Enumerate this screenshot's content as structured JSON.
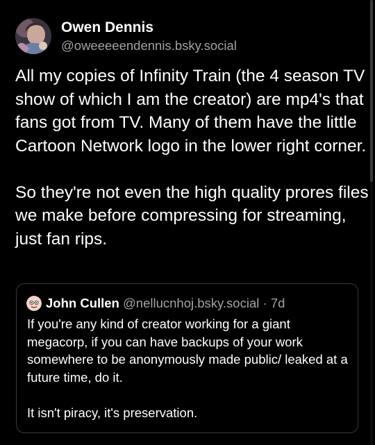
{
  "post": {
    "author": {
      "display_name": "Owen Dennis",
      "handle": "@oweeeeendennis.bsky.social",
      "avatar_icon": "profile-photo"
    },
    "text_paragraphs": [
      "All my copies of Infinity Train (the 4 season TV show of which I am the creator) are mp4's that fans got from TV. Many of them have the little Cartoon Network logo in the lower right corner.",
      "So they're not even the high quality prores files we make before compressing for streaming, just fan rips."
    ]
  },
  "quote": {
    "author": {
      "display_name": "John Cullen",
      "handle": "@nellucnhoj.bsky.social",
      "separator": "·",
      "time_ago": "7d",
      "avatar_icon": "cartoon-face-avatar"
    },
    "text_paragraphs": [
      "If you're any kind of creator working for a giant megacorp, if you can have backups of your work somewhere to be anonymously made public/ leaked at a future time, do it.",
      "It isn't piracy, it's preservation."
    ]
  },
  "colors": {
    "background": "#000000",
    "primary_text": "#ffffff",
    "secondary_text": "#a3a3a8",
    "card_border": "#3a3a40"
  }
}
